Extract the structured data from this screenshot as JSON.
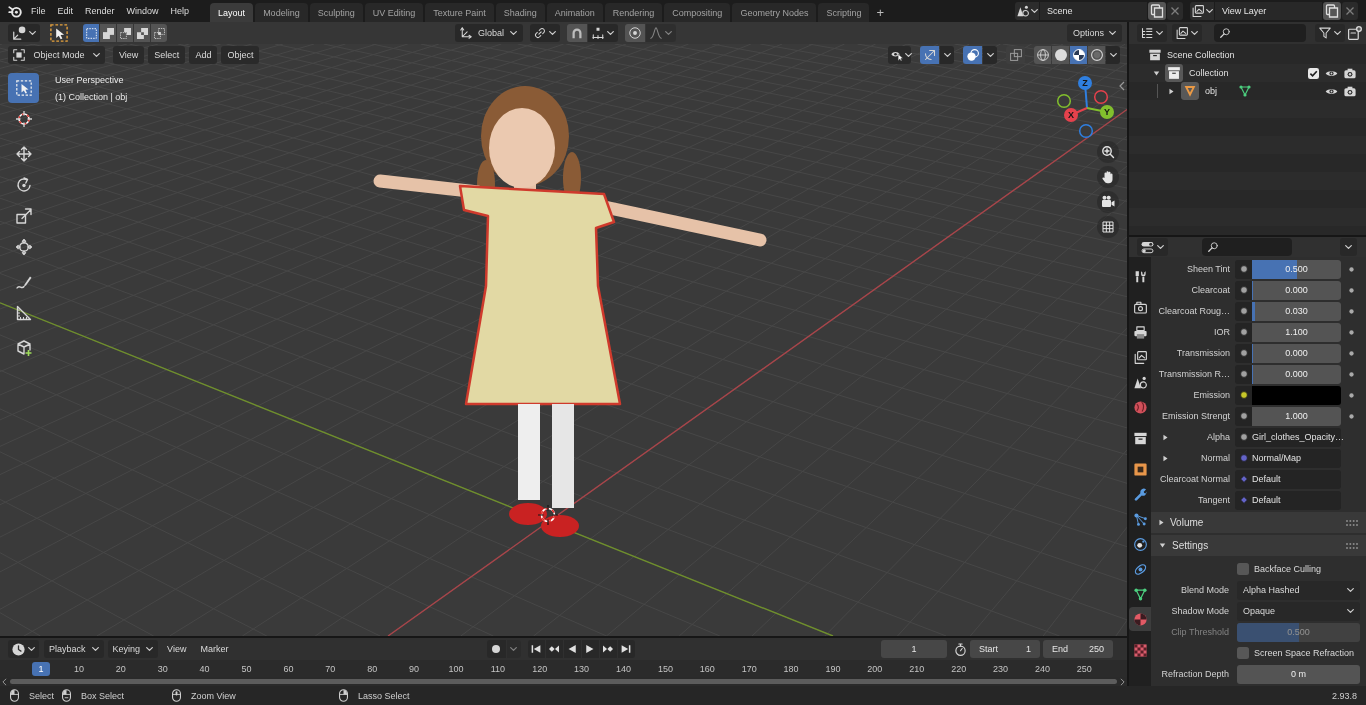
{
  "topbar": {
    "menus": [
      "File",
      "Edit",
      "Render",
      "Window",
      "Help"
    ],
    "workspaces": [
      {
        "label": "Layout",
        "selected": true
      },
      {
        "label": "Modeling",
        "selected": false
      },
      {
        "label": "Sculpting",
        "selected": false
      },
      {
        "label": "UV Editing",
        "selected": false
      },
      {
        "label": "Texture Paint",
        "selected": false
      },
      {
        "label": "Shading",
        "selected": false
      },
      {
        "label": "Animation",
        "selected": false
      },
      {
        "label": "Rendering",
        "selected": false
      },
      {
        "label": "Compositing",
        "selected": false
      },
      {
        "label": "Geometry Nodes",
        "selected": false
      },
      {
        "label": "Scripting",
        "selected": false
      }
    ],
    "add_workspace": "+",
    "scene": "Scene",
    "view_layer": "View Layer"
  },
  "viewport": {
    "tool_header": {
      "select_modes": [
        {
          "kind": "set",
          "selected": true
        },
        {
          "kind": "extend",
          "selected": false
        },
        {
          "kind": "subtract",
          "selected": false
        },
        {
          "kind": "difference",
          "selected": false
        },
        {
          "kind": "intersect",
          "selected": false
        }
      ],
      "orientation": "Global",
      "snap": {
        "on": false
      },
      "proportional": {
        "on": false
      },
      "options": "Options"
    },
    "header": {
      "mode": "Object Mode",
      "menus": [
        "View",
        "Select",
        "Add",
        "Object"
      ],
      "gizmos": {
        "on": true
      },
      "overlays": {
        "on": true
      },
      "xray": {
        "on": false
      },
      "shading": [
        {
          "kind": "wireframe",
          "selected": false
        },
        {
          "kind": "solid",
          "selected": false
        },
        {
          "kind": "material",
          "selected": true
        },
        {
          "kind": "rendered",
          "selected": false
        }
      ]
    },
    "info": {
      "view": "User Perspective",
      "object": "(1) Collection | obj"
    },
    "tools": [
      [
        {
          "kind": "select_box",
          "selected": true
        },
        {
          "kind": "cursor",
          "selected": false
        }
      ],
      [
        {
          "kind": "move",
          "selected": false
        },
        {
          "kind": "rotate",
          "selected": false
        },
        {
          "kind": "scale",
          "selected": false
        },
        {
          "kind": "transform",
          "selected": false
        }
      ],
      [
        {
          "kind": "annotate",
          "selected": false
        },
        {
          "kind": "measure",
          "selected": false
        }
      ],
      [
        {
          "kind": "add_cube",
          "selected": false
        }
      ]
    ],
    "gizmo": {
      "axes": [
        {
          "label": "Z",
          "color": "#2f7fe0"
        },
        {
          "label": "Y",
          "color": "#82bf2d"
        },
        {
          "label": "X",
          "color": "#e5414c"
        }
      ]
    }
  },
  "timeline": {
    "menus": [
      {
        "label": "Playback",
        "kind": "dropdown"
      },
      {
        "label": "Keying",
        "kind": "dropdown"
      },
      {
        "label": "View",
        "kind": "menu"
      },
      {
        "label": "Marker",
        "kind": "menu"
      }
    ],
    "auto_key": {
      "on": false
    },
    "controls": [
      {
        "kind": "jump_start"
      },
      {
        "kind": "prev_key"
      },
      {
        "kind": "play_reverse"
      },
      {
        "kind": "play"
      },
      {
        "kind": "next_key"
      },
      {
        "kind": "jump_end"
      }
    ],
    "frame": "1",
    "start": {
      "label": "Start",
      "value": "1"
    },
    "end": {
      "label": "End",
      "value": "250"
    },
    "ruler": {
      "current": "1",
      "labels": [
        "10",
        "20",
        "30",
        "40",
        "50",
        "60",
        "70",
        "80",
        "90",
        "100",
        "110",
        "120",
        "130",
        "140",
        "150",
        "160",
        "170",
        "180",
        "190",
        "200",
        "210",
        "220",
        "230",
        "240",
        "250"
      ]
    }
  },
  "outliner": {
    "tree": [
      {
        "label": "Scene Collection",
        "kind": "scene_collection",
        "children": [
          {
            "label": "Collection",
            "kind": "collection",
            "expanded": true,
            "checked": true,
            "visible": true,
            "renderable": true,
            "children": [
              {
                "label": "obj",
                "kind": "mesh_object",
                "expanded": false,
                "visible": true,
                "renderable": true
              }
            ]
          }
        ]
      }
    ]
  },
  "properties": {
    "tabs": [
      [
        {
          "kind": "tool",
          "selected": false
        }
      ],
      [
        {
          "kind": "render",
          "selected": false
        },
        {
          "kind": "output",
          "selected": false
        },
        {
          "kind": "view_layer",
          "selected": false
        },
        {
          "kind": "scene",
          "selected": false
        },
        {
          "kind": "world",
          "selected": false
        }
      ],
      [
        {
          "kind": "collection",
          "selected": false
        }
      ],
      [
        {
          "kind": "object",
          "selected": false
        },
        {
          "kind": "modifiers",
          "selected": false
        },
        {
          "kind": "particles",
          "selected": false
        },
        {
          "kind": "physics",
          "selected": false
        },
        {
          "kind": "constraints",
          "selected": false
        },
        {
          "kind": "data",
          "selected": false
        },
        {
          "kind": "material",
          "selected": true
        }
      ],
      [
        {
          "kind": "texture",
          "selected": false
        }
      ]
    ],
    "inputs": [
      {
        "label": "Sheen Tint",
        "kind": "factor",
        "socket": {
          "color": "#a1a1a1"
        },
        "value": "0.500",
        "level": 0.5,
        "decorator": true
      },
      {
        "label": "Clearcoat",
        "kind": "factor",
        "socket": {
          "color": "#a1a1a1"
        },
        "value": "0.000",
        "level": 0,
        "decorator": true
      },
      {
        "label": "Clearcoat Roug…",
        "kind": "factor",
        "socket": {
          "color": "#a1a1a1"
        },
        "value": "0.030",
        "level": 0.03,
        "decorator": true
      },
      {
        "label": "IOR",
        "kind": "number",
        "socket": {
          "color": "#a1a1a1"
        },
        "value": "1.100",
        "decorator": true
      },
      {
        "label": "Transmission",
        "kind": "factor",
        "socket": {
          "color": "#a1a1a1"
        },
        "value": "0.000",
        "level": 0,
        "decorator": true
      },
      {
        "label": "Transmission R…",
        "kind": "factor",
        "socket": {
          "color": "#a1a1a1"
        },
        "value": "0.000",
        "level": 0,
        "decorator": true
      },
      {
        "label": "Emission",
        "kind": "color",
        "socket": {
          "color": "#c7c729"
        },
        "swatch": {
          "color": "#000000"
        },
        "decorator": true
      },
      {
        "label": "Emission Strengt",
        "kind": "number",
        "socket": {
          "color": "#a1a1a1"
        },
        "value": "1.000",
        "decorator": true
      },
      {
        "label": "Alpha",
        "kind": "link",
        "expanded": false,
        "socket": {
          "color": "#a1a1a1"
        },
        "value": "Girl_clothes_Opacity…",
        "decorator": false
      },
      {
        "label": "Normal",
        "kind": "link",
        "expanded": false,
        "socket": {
          "color": "#6363c7"
        },
        "value": "Normal/Map",
        "decorator": false
      },
      {
        "label": "Clearcoat Normal",
        "kind": "vector",
        "socket": {
          "color": "#6363c7"
        },
        "value": "Default",
        "decorator": false
      },
      {
        "label": "Tangent",
        "kind": "vector",
        "socket": {
          "color": "#6363c7"
        },
        "value": "Default",
        "decorator": false
      }
    ],
    "panels": [
      {
        "label": "Volume",
        "expanded": false
      },
      {
        "label": "Settings",
        "expanded": true,
        "items": [
          {
            "kind": "checkbox",
            "label": "Backface Culling",
            "checked": false,
            "disabled": false
          },
          {
            "kind": "dropdown",
            "label": "Blend Mode",
            "value": "Alpha Hashed",
            "disabled": false
          },
          {
            "kind": "dropdown",
            "label": "Shadow Mode",
            "value": "Opaque",
            "disabled": false
          },
          {
            "kind": "factor",
            "label": "Clip Threshold",
            "value": "0.500",
            "level": 0.5,
            "disabled": true
          },
          {
            "kind": "checkbox",
            "label": "Screen Space Refraction",
            "checked": false,
            "disabled": false
          },
          {
            "kind": "number",
            "label": "Refraction Depth",
            "value": "0 m",
            "disabled": false
          }
        ]
      }
    ]
  },
  "status_bar": {
    "hints": [
      {
        "kind": "left_click",
        "label": "Select"
      },
      {
        "kind": "left_drag",
        "label": "Box Select"
      },
      {
        "kind": "middle_drag",
        "label": "Zoom View"
      },
      {
        "kind": "right_drag",
        "label": "Lasso Select"
      }
    ],
    "version": "2.93.8"
  }
}
